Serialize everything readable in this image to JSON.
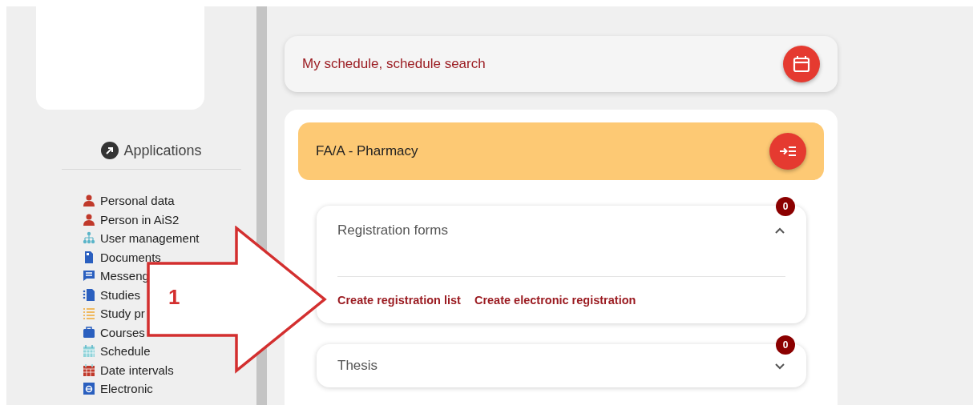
{
  "sidebar": {
    "heading": "Applications",
    "items": [
      {
        "label": "Personal data"
      },
      {
        "label": "Person in AiS2"
      },
      {
        "label": "User management"
      },
      {
        "label": "Documents"
      },
      {
        "label": "Messeng"
      },
      {
        "label": "Studies"
      },
      {
        "label": "Study pr"
      },
      {
        "label": "Courses"
      },
      {
        "label": "Schedule"
      },
      {
        "label": "Date intervals"
      },
      {
        "label": "Electronic"
      }
    ]
  },
  "schedule_link": {
    "label": "My schedule, schedule search"
  },
  "study_program": {
    "title": "FA/A - Pharmacy",
    "sections": [
      {
        "title": "Registration forms",
        "badge": "0",
        "expanded": true,
        "links": [
          "Create registration list",
          "Create electronic registration"
        ]
      },
      {
        "title": "Thesis",
        "badge": "0",
        "expanded": false
      }
    ]
  },
  "annotation": {
    "label": "1"
  }
}
